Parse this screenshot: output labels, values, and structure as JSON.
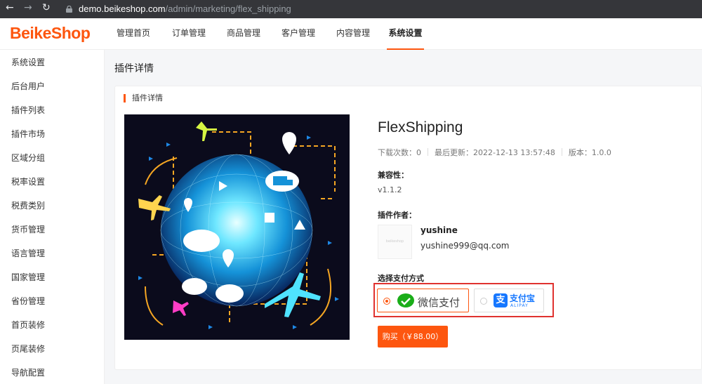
{
  "browser": {
    "url_host": "demo.beikeshop.com",
    "url_path": "/admin/marketing/flex_shipping"
  },
  "logo": "BeikeShop",
  "top_menu": [
    "管理首页",
    "订单管理",
    "商品管理",
    "客户管理",
    "内容管理",
    "系统设置"
  ],
  "active_menu": "系统设置",
  "sidebar": [
    "系统设置",
    "后台用户",
    "插件列表",
    "插件市场",
    "区域分组",
    "税率设置",
    "税费类别",
    "货币管理",
    "语言管理",
    "国家管理",
    "省份管理",
    "首页装修",
    "页尾装修",
    "导航配置"
  ],
  "page_title": "插件详情",
  "card_title": "插件详情",
  "plugin": {
    "name": "FlexShipping",
    "downloads": "下载次数：0",
    "updated": "最后更新：2022-12-13 13:57:48",
    "version": "版本：1.0.0",
    "compat_label": "兼容性：",
    "compat_value": "v1.1.2",
    "author_label": "插件作者：",
    "author_name": "yushine",
    "author_email": "yushine999@qq.com",
    "avatar_text": "beikeshop"
  },
  "payment": {
    "label": "选择支付方式",
    "wechat": "微信支付",
    "alipay_cn": "支付宝",
    "alipay_en": "ALIPAY",
    "selected": "wechat"
  },
  "buy_button": "购买（￥88.00）",
  "colors": {
    "accent": "#fd560f",
    "highlight_border": "#e0322f",
    "wechat_green": "#1aad19",
    "alipay_blue": "#1677ff"
  }
}
